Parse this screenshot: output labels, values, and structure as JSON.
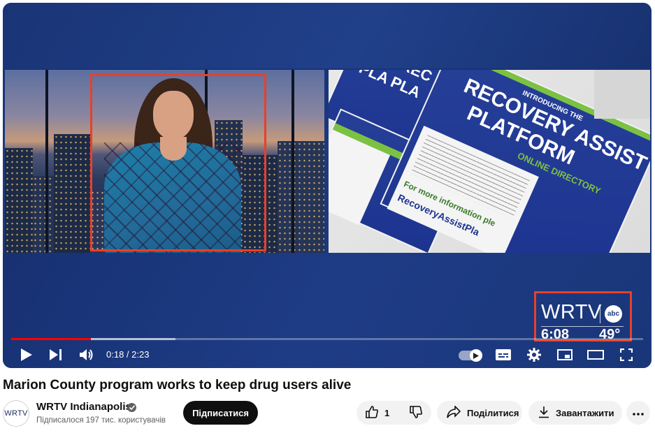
{
  "player": {
    "current_time": "0:18",
    "duration": "2:23",
    "time_display": "0:18 / 2:23",
    "progress_played": 0.126,
    "progress_buffered": 0.26,
    "icons": {
      "play": "play-icon",
      "next": "next-icon",
      "volume": "volume-icon",
      "autoplay": "autoplay-toggle-icon",
      "captions": "subtitles-icon",
      "settings": "gear-icon",
      "miniplayer": "miniplayer-icon",
      "theater": "theater-mode-icon",
      "fullscreen": "fullscreen-icon"
    },
    "overlay": {
      "brand": "WRTV",
      "network": "abc",
      "time": "6:08",
      "temperature": "49°"
    },
    "flyer_text": {
      "line1": "RECOVERY ASSIST",
      "line2": "PLATFORM",
      "line3": "ONLINE DIRECTORY",
      "small1": "INTRODUCING THE",
      "small2": "REC REC PLATFORM",
      "small3": "PLA PLA",
      "footer": "RecoveryAssistPla",
      "more_info": "For more information ple"
    }
  },
  "video": {
    "title": "Marion County program works to keep drug users alive"
  },
  "channel": {
    "avatar_text": "WRTV",
    "name": "WRTV Indianapolis",
    "subscribers": "Підписалося 197 тис. користувачів",
    "subscribe_label": "Підписатися"
  },
  "actions": {
    "like_count": "1",
    "share_label": "Поділитися",
    "download_label": "Завантажити"
  },
  "colors": {
    "progress": "#ff0000",
    "highlight_box": "#e8402a",
    "player_bg": "#1c3a82"
  }
}
